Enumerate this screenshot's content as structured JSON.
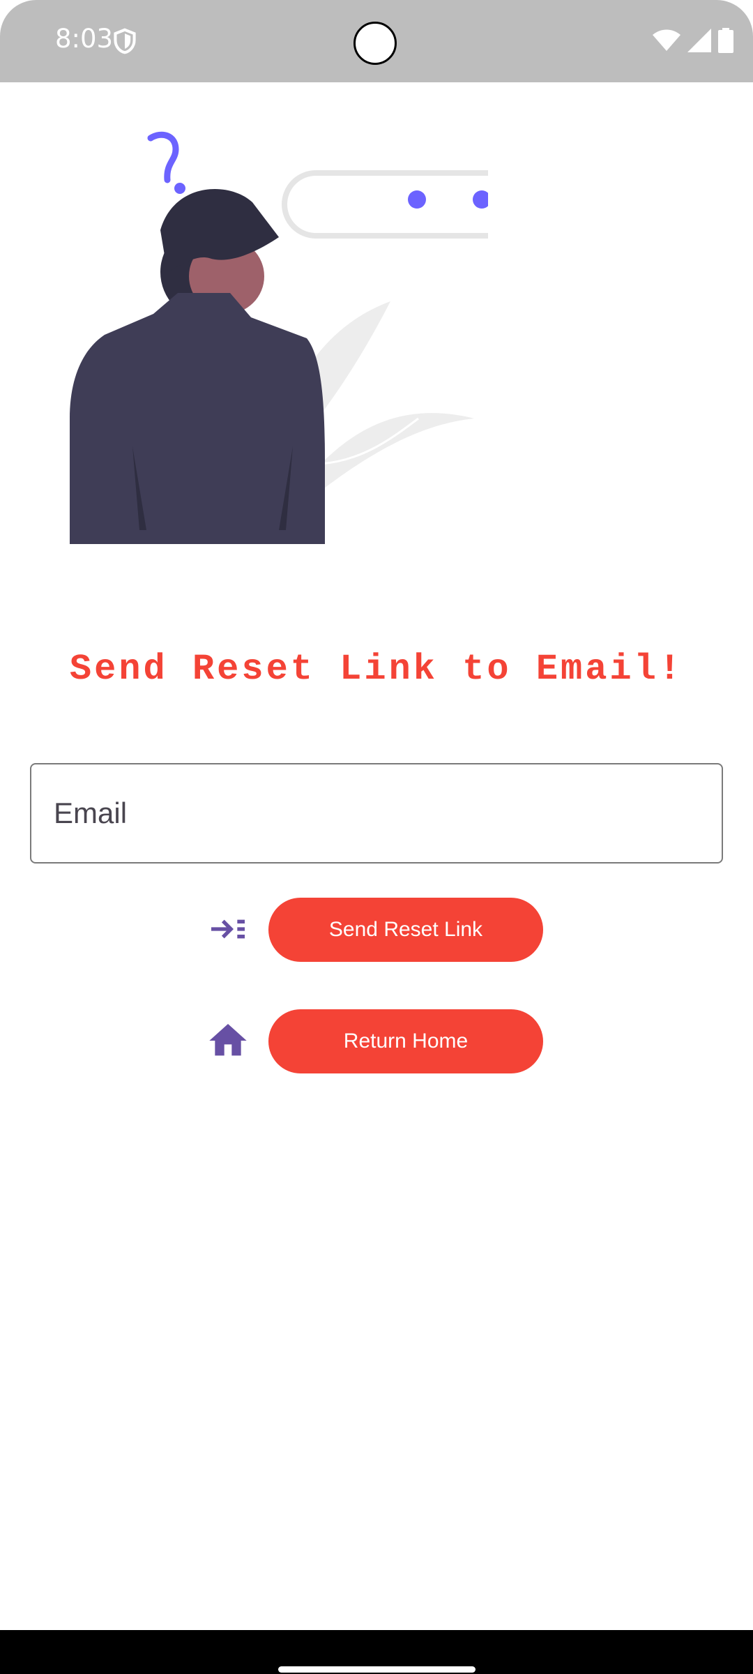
{
  "status_bar": {
    "time": "8:03",
    "icons": [
      "shield-icon",
      "wifi-icon",
      "signal-icon",
      "battery-icon"
    ]
  },
  "main": {
    "title": "Send Reset Link to Email!",
    "email_placeholder": "Email",
    "email_value": "",
    "send_button": {
      "label": "Send Reset Link",
      "icon": "indent-arrow-icon"
    },
    "home_button": {
      "label": "Return Home",
      "icon": "home-icon"
    }
  },
  "colors": {
    "accent": "#f44336",
    "icon_purple": "#6750a4",
    "illustration_purple": "#6c63ff",
    "status_bar": "#bdbdbd"
  }
}
